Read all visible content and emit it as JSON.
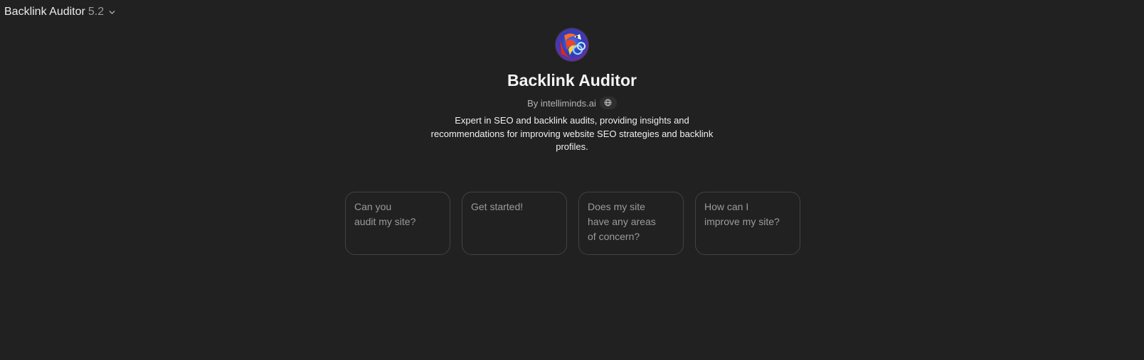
{
  "header": {
    "model_name": "Backlink Auditor",
    "model_version": "5.2",
    "chevron_icon": "chevron-down-icon"
  },
  "gpt": {
    "title": "Backlink Auditor",
    "byline": "By intelliminds.ai",
    "globe_icon": "globe-icon",
    "description": "Expert in SEO and backlink audits, providing insights and recommendations for improving website SEO strategies and backlink profiles."
  },
  "starters": [
    {
      "lines": [
        "Can you",
        "audit my site?"
      ]
    },
    {
      "lines": [
        "Get started!"
      ]
    },
    {
      "lines": [
        "Does my site",
        "have any areas",
        "of concern?"
      ]
    },
    {
      "lines": [
        "How can I",
        "improve my site?"
      ]
    }
  ],
  "colors": {
    "background": "#212121",
    "card_border": "#424242",
    "muted_text": "#9b9b9b"
  }
}
